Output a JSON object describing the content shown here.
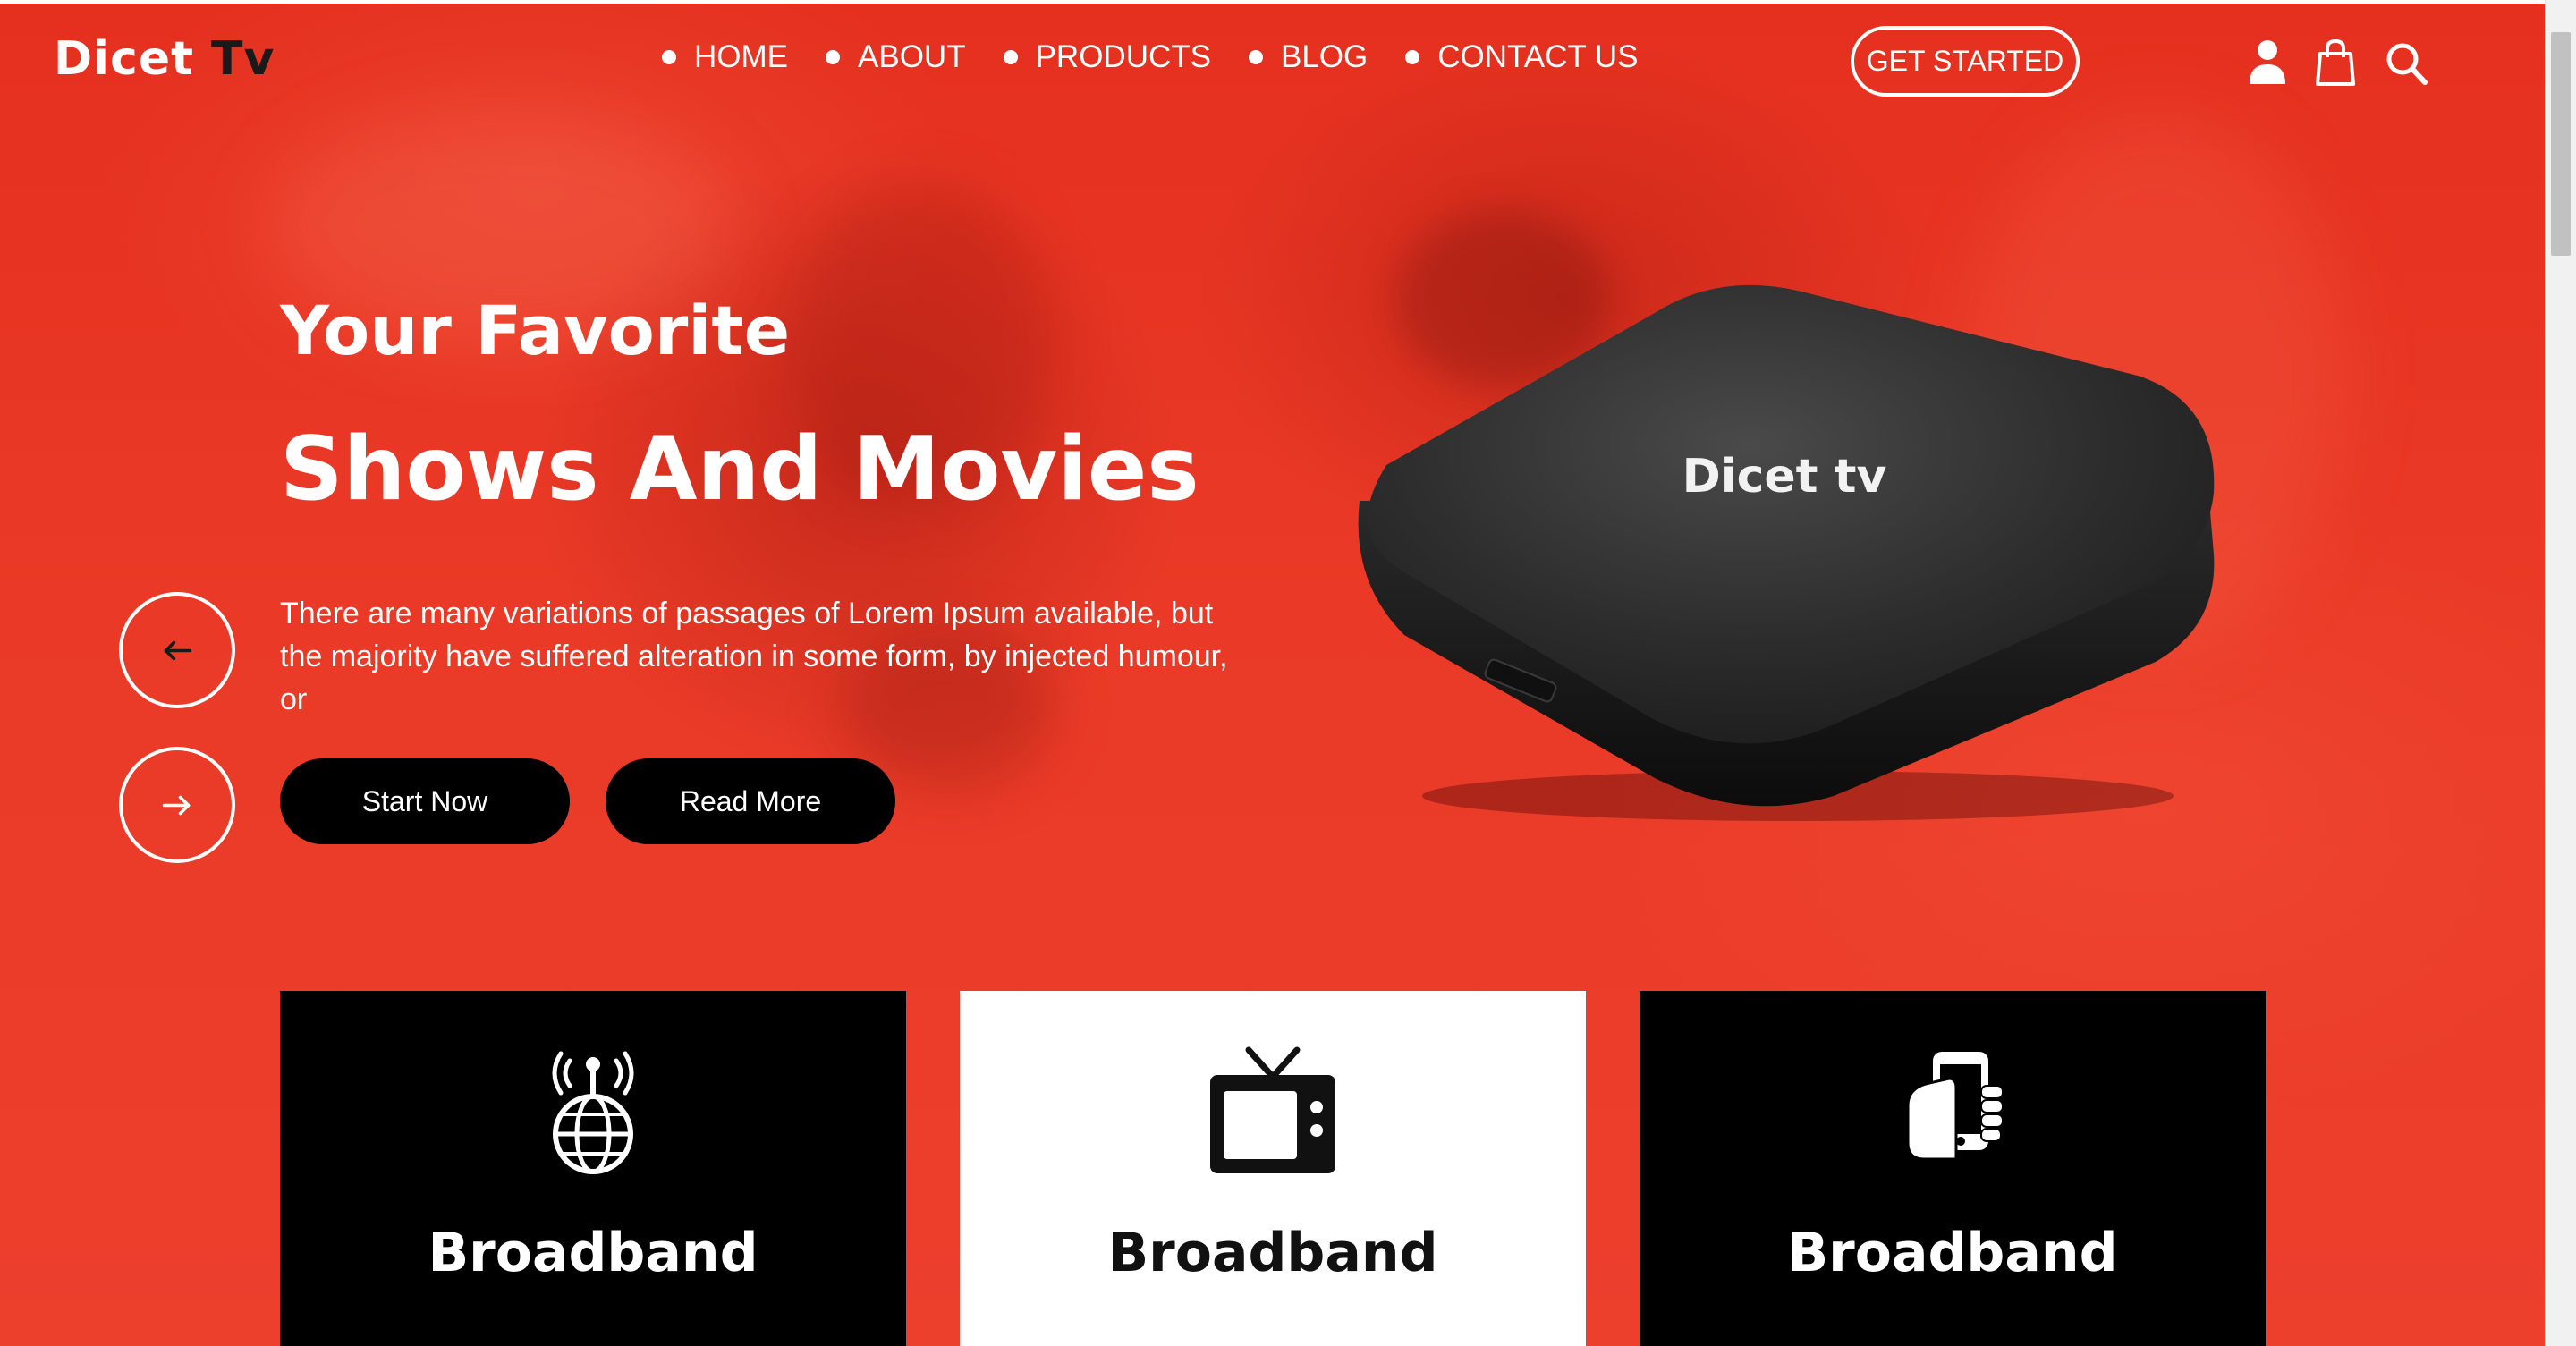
{
  "brand": {
    "name": "Dicet",
    "suffix": "Tv"
  },
  "nav": [
    {
      "label": "HOME"
    },
    {
      "label": "ABOUT"
    },
    {
      "label": "PRODUCTS"
    },
    {
      "label": "BLOG"
    },
    {
      "label": "CONTACT US"
    }
  ],
  "header": {
    "cta_label": "GET STARTED",
    "icons": [
      "user-icon",
      "shopping-bag-icon",
      "search-icon"
    ]
  },
  "hero": {
    "title_line1": "Your Favorite",
    "title_line2": "Shows And Movies",
    "description": "There are many variations of passages of Lorem Ipsum available, but the majority have suffered alteration in some form, by injected humour, or",
    "primary_button": "Start Now",
    "secondary_button": "Read More",
    "device_label": "Dicet tv",
    "prev_icon": "arrow-left-icon",
    "next_icon": "arrow-right-icon"
  },
  "services": [
    {
      "title": "Broadband",
      "icon": "antenna-globe-icon"
    },
    {
      "title": "Broadband",
      "icon": "tv-icon"
    },
    {
      "title": "Broadband",
      "icon": "phone-hand-icon"
    }
  ],
  "colors": {
    "accent": "#e5301f",
    "dark": "#000000",
    "light": "#ffffff"
  }
}
